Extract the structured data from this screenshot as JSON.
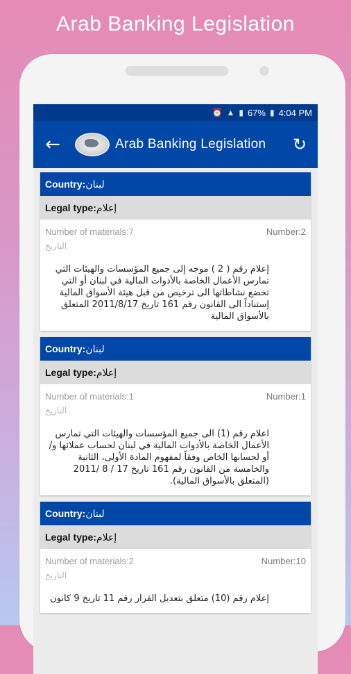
{
  "promo": {
    "title": "Arab Banking Legislation"
  },
  "status_bar": {
    "battery": "67%",
    "time": "4:04 PM"
  },
  "app_bar": {
    "title": "Arab Banking Legislation"
  },
  "labels": {
    "country": "Country:",
    "legal_type": "Legal type:",
    "materials": "Number of materials:",
    "number": "Number:",
    "date": "التاريخ"
  },
  "cards": [
    {
      "country": "لبنان",
      "legal_type": "إعلام",
      "materials": "7",
      "number": "2",
      "description": "إعلام رقم ( 2 ) موجه إلى جميع المؤسسات والهيئات التي تمارس الأعمال الخاصة بالأدوات المالية في لبنان أو التي تخضع نشاطاتها الى ترخيص من قبل هيئة الأسواق المالية إستناداً الى القانون رقم 161 تاريخ 2011/8/17 المتعلق بالأسواق المالية"
    },
    {
      "country": "لبنان",
      "legal_type": "إعلام",
      "materials": "1",
      "number": "1",
      "description": "اعلام رقم (1) الى جميع المؤسسات والهيئات التي تمارس الأعمال الخاصة بالأدوات المالية في لبنان لحساب عملائها و/أو لحسابها الخاص وفقاً لمفهوم المادة الأولى، الثانية والخامسة من القانون رقم 161 تاريخ 17 / 8 /2011 (المتعلق بالأسواق المالية)."
    },
    {
      "country": "لبنان",
      "legal_type": "إعلام",
      "materials": "2",
      "number": "10",
      "description": "إعلام رقم (10) متعلق بتعديل القرار رقم 11 تاريخ 9 كانون"
    }
  ]
}
